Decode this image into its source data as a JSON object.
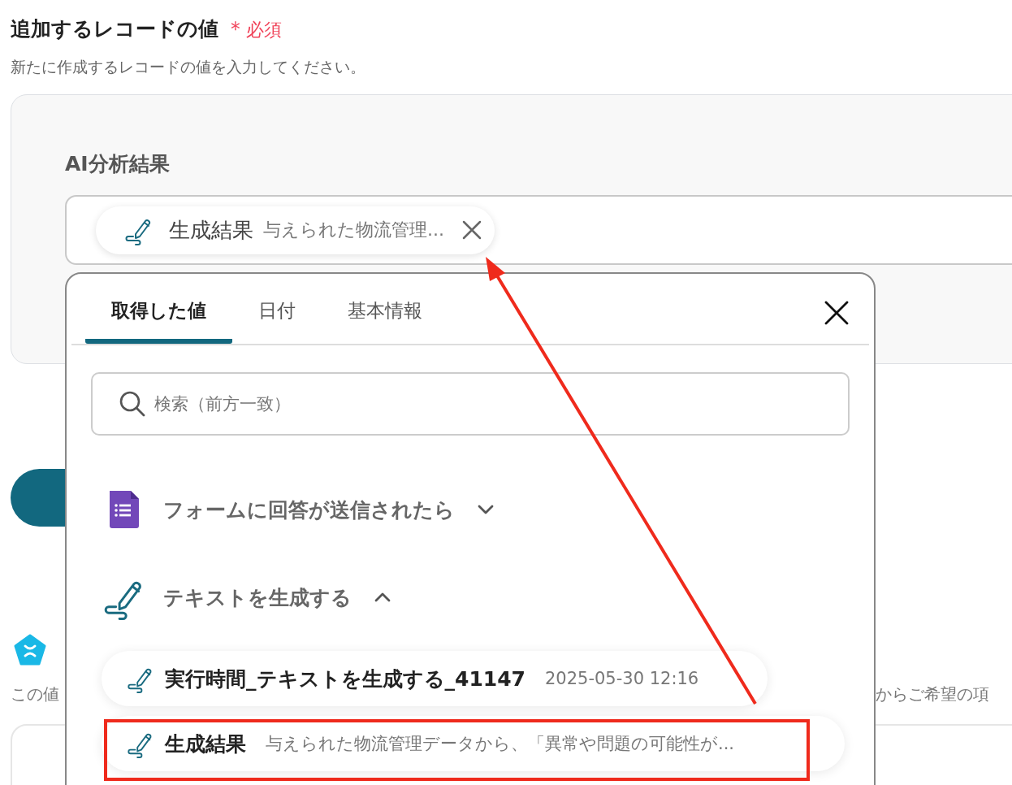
{
  "section": {
    "title": "追加するレコードの値",
    "required_mark": "＊",
    "required_label": "必須",
    "description": "新たに作成するレコードの値を入力してください。"
  },
  "field": {
    "label": "AI分析結果",
    "token": {
      "name": "生成結果",
      "preview": "与えられた物流管理..."
    }
  },
  "background": {
    "next_description_start": "この値",
    "next_description_end": "からご希望の項"
  },
  "picker": {
    "tabs": [
      {
        "label": "取得した値",
        "selected": true
      },
      {
        "label": "日付",
        "selected": false
      },
      {
        "label": "基本情報",
        "selected": false
      }
    ],
    "search": {
      "placeholder": "検索（前方一致）"
    },
    "groups": [
      {
        "kind": "form",
        "title": "フォームに回答が送信されたら",
        "expanded": false
      },
      {
        "kind": "text",
        "title": "テキストを生成する",
        "expanded": true,
        "items": [
          {
            "name": "実行時間_テキストを生成する_41147",
            "value": "2025-05-30 12:16",
            "highlighted": false
          },
          {
            "name": "生成結果",
            "value": "与えられた物流管理データから、「異常や問題の可能性が...",
            "highlighted": true
          }
        ]
      }
    ]
  }
}
